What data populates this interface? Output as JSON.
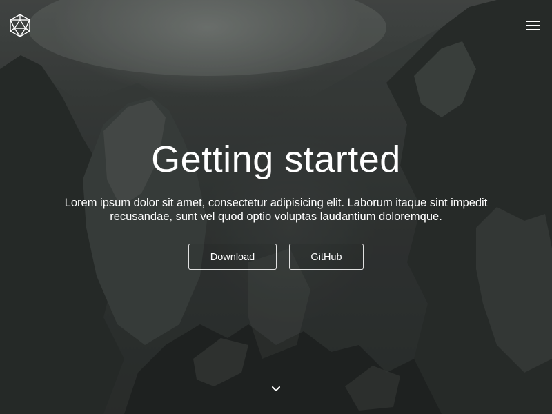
{
  "header": {
    "logo_icon": "icosahedron-logo-icon",
    "menu_icon": "hamburger-menu-icon"
  },
  "hero": {
    "title": "Getting started",
    "lead": "Lorem ipsum dolor sit amet, consectetur adipisicing elit. Laborum itaque sint impedit recusandae, sunt vel quod optio voluptas laudantium doloremque.",
    "buttons": {
      "download_label": "Download",
      "github_label": "GitHub"
    },
    "scroll_icon": "chevron-down-icon"
  },
  "colors": {
    "text": "#ffffff",
    "background_dark": "#1f2120",
    "background_mist": "#8f938f"
  }
}
